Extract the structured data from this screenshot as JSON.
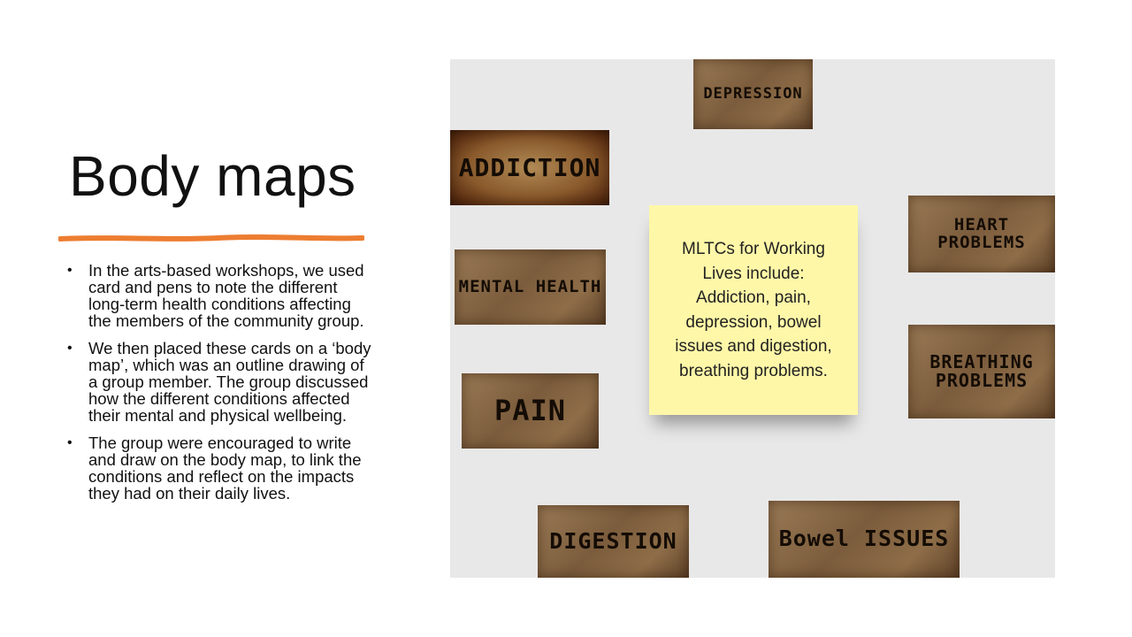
{
  "slide": {
    "title": "Body maps",
    "accent_color": "#ed7d31",
    "bullets": [
      "In the arts-based workshops, we used card and pens to note the different long-term health conditions affecting the members of the community group.",
      "We then placed these cards on a ‘body map’, which was an outline drawing of a group member. The group discussed how the different conditions affected their mental and physical wellbeing.",
      "The group were encouraged to write and draw on the body map, to link the conditions and reflect on the impacts they had on their daily lives."
    ],
    "bullet_glyph": "•"
  },
  "photo": {
    "cards": {
      "depression": "DEPRESSION",
      "addiction": "ADDICTION",
      "heart": "HEART PROBLEMS",
      "mental": "MENTAL HEALTH",
      "breathing": "BREATHING\nPROBLEMS",
      "pain": "PAIN",
      "digestion": "DIGESTION",
      "bowel": "Bowel ISSUES"
    },
    "sticky_note": "MLTCs for Working\nLives include:\nAddiction, pain,\ndepression, bowel\nissues and digestion,\nbreathing problems."
  }
}
